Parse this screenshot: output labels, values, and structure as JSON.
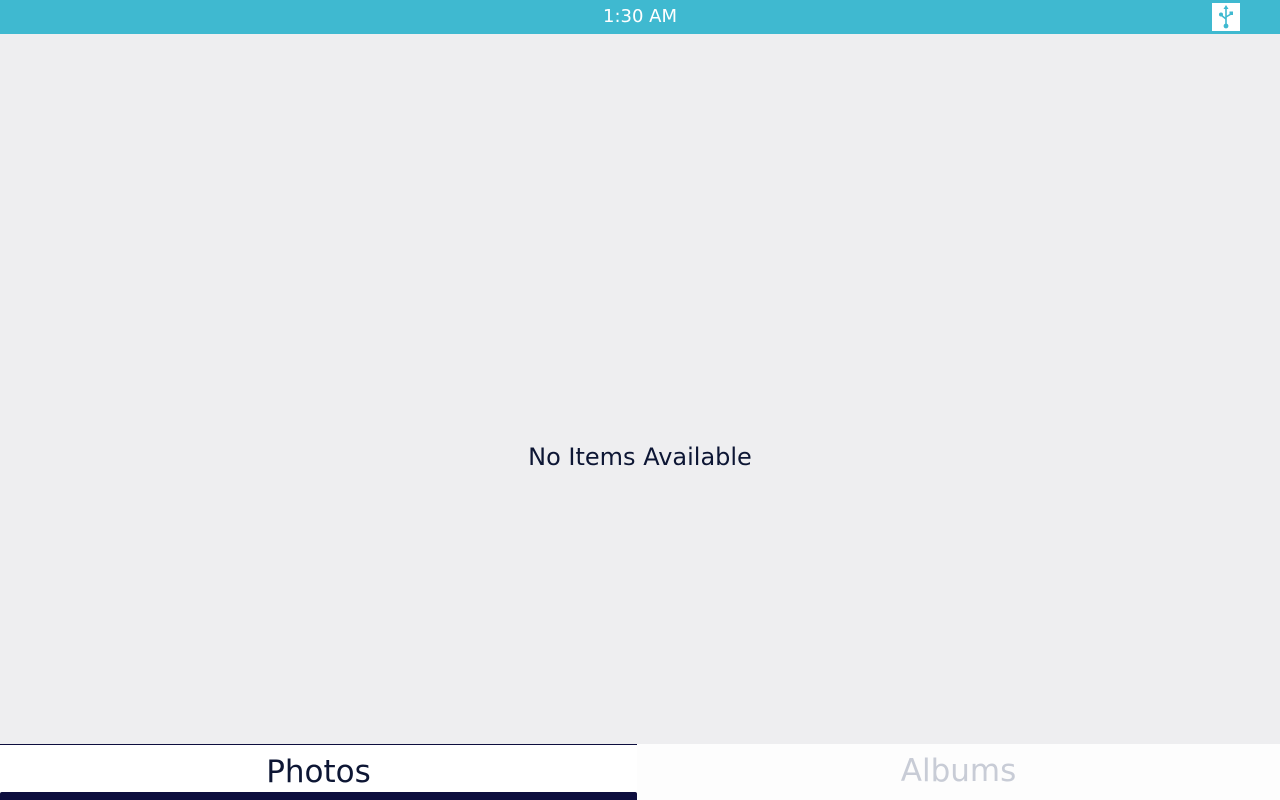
{
  "status_bar": {
    "time": "1:30 AM",
    "usb_icon": "usb-icon",
    "color": "#3fb9d0"
  },
  "content": {
    "empty_message": "No Items Available"
  },
  "tabs": [
    {
      "label": "Photos",
      "selected": true
    },
    {
      "label": "Albums",
      "selected": false
    }
  ],
  "colors": {
    "background": "#eeeef0",
    "tab_active_text": "#0d1634",
    "tab_inactive_text": "#c8ccd6",
    "indicator": "#0d0e3e"
  }
}
